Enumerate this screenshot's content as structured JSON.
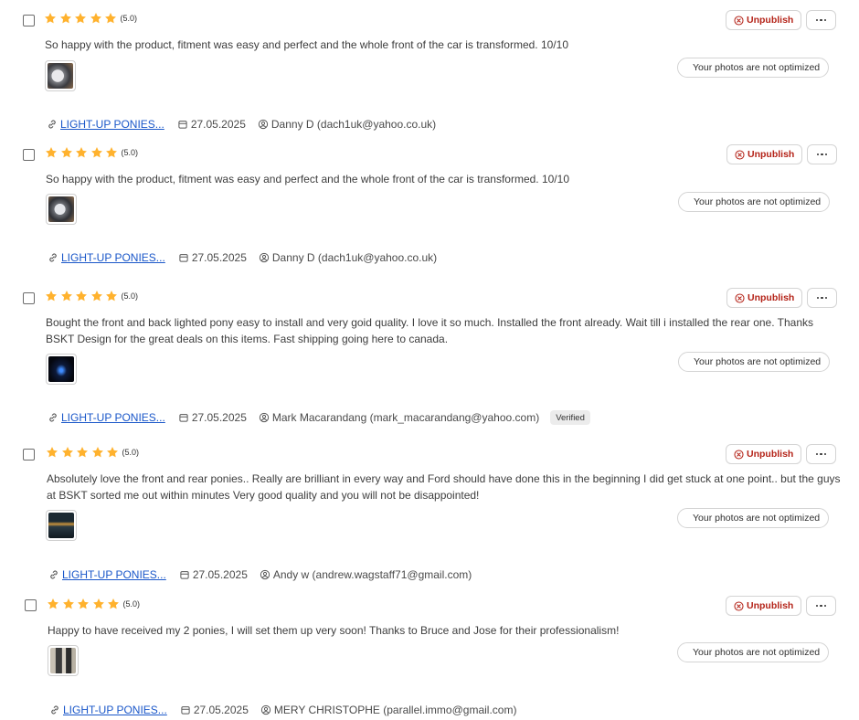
{
  "actions": {
    "unpublish_label": "Unpublish",
    "photos_status": "Your photos are not optimized"
  },
  "colors": {
    "star": "#ffb22e",
    "unpublish": "#b42318",
    "link": "#1a57c9"
  },
  "reviews": [
    {
      "rating": 5,
      "score_label": "(5.0)",
      "text": "So happy with the product, fitment was easy and perfect and the whole front of the car is transformed. 10/10",
      "photo": "wheel-photo",
      "product": "LIGHT-UP PONIES...",
      "date": "27.05.2025",
      "author": "Danny D (dach1uk@yahoo.co.uk)",
      "verified": ""
    },
    {
      "rating": 5,
      "score_label": "(5.0)",
      "text": "So happy with the product, fitment was easy and perfect and the whole front of the car is transformed. 10/10",
      "photo": "wheel-photo",
      "product": "LIGHT-UP PONIES...",
      "date": "27.05.2025",
      "author": "Danny D (dach1uk@yahoo.co.uk)",
      "verified": ""
    },
    {
      "rating": 5,
      "score_label": "(5.0)",
      "text": "Bought the front and back lighted pony easy to install and very goid quality. I love it so much. Installed the front already. Wait till i installed the rear one. Thanks BSKT Design for the great deals on this items. Fast shipping going here to canada.",
      "photo": "night-car-photo",
      "product": "LIGHT-UP PONIES...",
      "date": "27.05.2025",
      "author": "Mark Macarandang (mark_macarandang@yahoo.com)",
      "verified": "Verified"
    },
    {
      "rating": 5,
      "score_label": "(5.0)",
      "text": "Absolutely love the front and rear ponies.. Really are brilliant in every way and Ford should have done this in the beginning I did get stuck at one point.. but the guys at BSKT sorted me out within minutes Very good quality and you will not be disappointed!",
      "photo": "car-front-photo",
      "product": "LIGHT-UP PONIES...",
      "date": "27.05.2025",
      "author": "Andy w (andrew.wagstaff71@gmail.com)",
      "verified": ""
    },
    {
      "rating": 5,
      "score_label": "(5.0)",
      "text": "Happy to have received my 2 ponies, I will set them up very soon! Thanks to Bruce and Jose for their professionalism!",
      "photo": "package-photo",
      "product": "LIGHT-UP PONIES...",
      "date": "27.05.2025",
      "author": "MERY CHRISTOPHE (parallel.immo@gmail.com)",
      "verified": ""
    }
  ]
}
